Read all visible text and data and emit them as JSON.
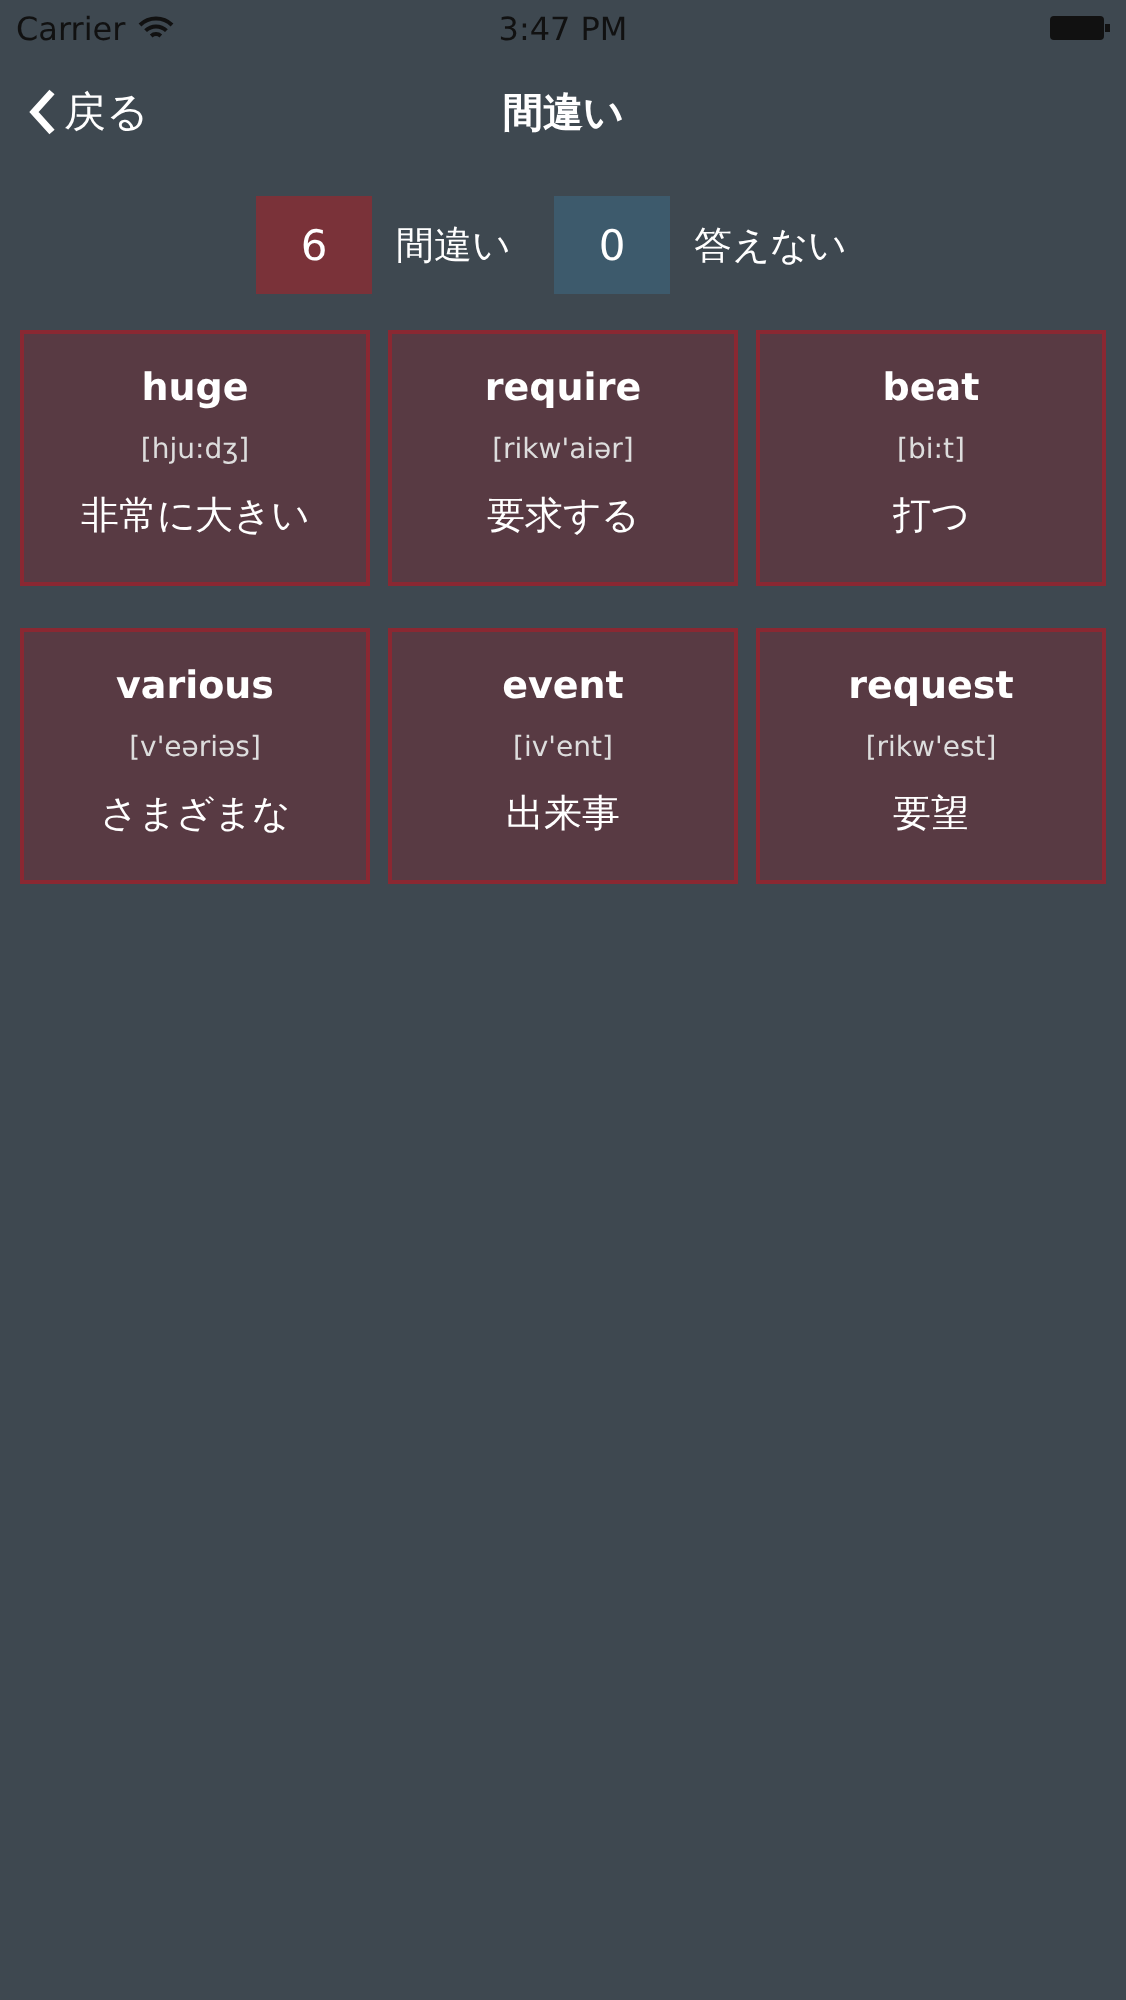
{
  "status_bar": {
    "carrier": "Carrier",
    "time": "3:47 PM"
  },
  "nav": {
    "back": "戻る",
    "title": "間違い"
  },
  "counters": [
    {
      "count": "6",
      "label": "間違い",
      "color": "#7a3239"
    },
    {
      "count": "0",
      "label": "答えない",
      "color": "#3d5a6c"
    }
  ],
  "cards": [
    {
      "word": "huge",
      "pronunciation": "[hju:dʒ]",
      "meaning": "非常に大きい"
    },
    {
      "word": "require",
      "pronunciation": "[rikw'aiər]",
      "meaning": "要求する"
    },
    {
      "word": "beat",
      "pronunciation": "[bi:t]",
      "meaning": "打つ"
    },
    {
      "word": "various",
      "pronunciation": "[v'eəriəs]",
      "meaning": "さまざまな"
    },
    {
      "word": "event",
      "pronunciation": "[iv'ent]",
      "meaning": "出来事"
    },
    {
      "word": "request",
      "pronunciation": "[rikw'est]",
      "meaning": "要望"
    }
  ]
}
